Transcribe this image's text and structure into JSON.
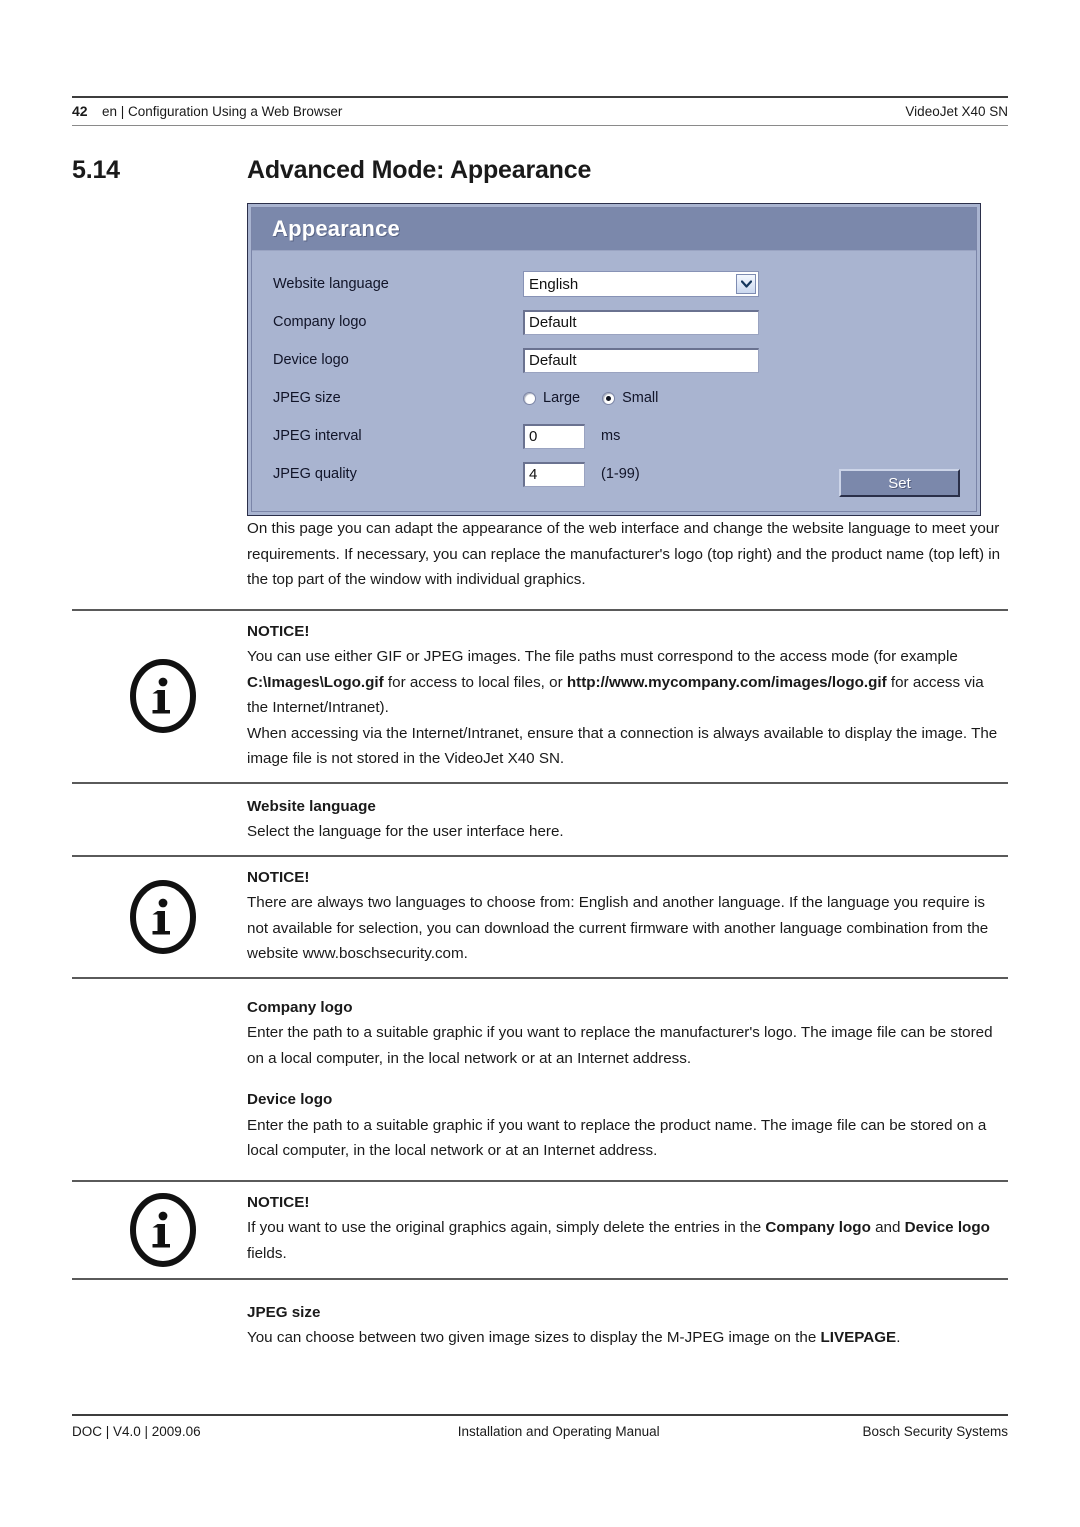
{
  "header": {
    "page_number": "42",
    "breadcrumb": "en | Configuration Using a Web Browser",
    "product": "VideoJet X40 SN"
  },
  "section": {
    "number": "5.14",
    "title": "Advanced Mode: Appearance"
  },
  "screenshot": {
    "panel_title": "Appearance",
    "accent_header_color": "#7b88ab",
    "panel_body_color": "#a9b4d0",
    "rows": [
      {
        "label": "Website language",
        "control": "select",
        "value": "English"
      },
      {
        "label": "Company logo",
        "control": "text",
        "value": "Default"
      },
      {
        "label": "Device logo",
        "control": "text",
        "value": "Default"
      },
      {
        "label": "JPEG size",
        "control": "radio",
        "options": [
          "Large",
          "Small"
        ],
        "selected": "Small"
      },
      {
        "label": "JPEG interval",
        "control": "text",
        "value": "0",
        "unit": "ms"
      },
      {
        "label": "JPEG quality",
        "control": "text",
        "value": "4",
        "unit": "(1-99)"
      }
    ],
    "submit_label": "Set"
  },
  "body": {
    "intro": "On this page you can adapt the appearance of the web interface and change the website language to meet your requirements. If necessary, you can replace the manufacturer's logo (top right) and the product name (top left) in the top part of the window with individual graphics.",
    "notice_label": "NOTICE!",
    "notice1": {
      "line1": "You can use either GIF or JPEG images. The file paths must correspond to the access mode (for example ",
      "bold1": "C:\\Images\\Logo.gif",
      "line2": " for access to local files, or ",
      "bold2": "http://www.mycompany.com/images/logo.gif",
      "line3": " for access via the Internet/Intranet).",
      "line4": "When accessing via the Internet/Intranet, ensure that a connection is always available to display the image. The image file is not stored in the VideoJet X40 SN."
    },
    "website_language": {
      "heading": "Website language",
      "text": "Select the language for the user interface here."
    },
    "notice2": {
      "text": "There are always two languages to choose from: English and another language. If the language you require is not available for selection, you can download the current firmware with another language combination from the website www.boschsecurity.com."
    },
    "company_logo": {
      "heading": "Company logo",
      "text": "Enter the path to a suitable graphic if you want to replace the manufacturer's logo. The image file can be stored on a local computer, in the local network or at an Internet address."
    },
    "device_logo": {
      "heading": "Device logo",
      "text": "Enter the path to a suitable graphic if you want to replace the product name. The image file can be stored on a local computer, in the local network or at an Internet address."
    },
    "notice3": {
      "pre": "If you want to use the original graphics again, simply delete the entries in the ",
      "bold1": "Company logo",
      "mid": " and ",
      "bold2": "Device logo",
      "post": " fields."
    },
    "jpeg_size": {
      "heading": "JPEG size",
      "text": "You can choose between two given image sizes to display the M-JPEG image on the ",
      "bold": "LIVEPAGE",
      "post": "."
    }
  },
  "footer": {
    "left": "DOC | V4.0 | 2009.06",
    "center": "Installation and Operating Manual",
    "right": "Bosch Security Systems"
  }
}
